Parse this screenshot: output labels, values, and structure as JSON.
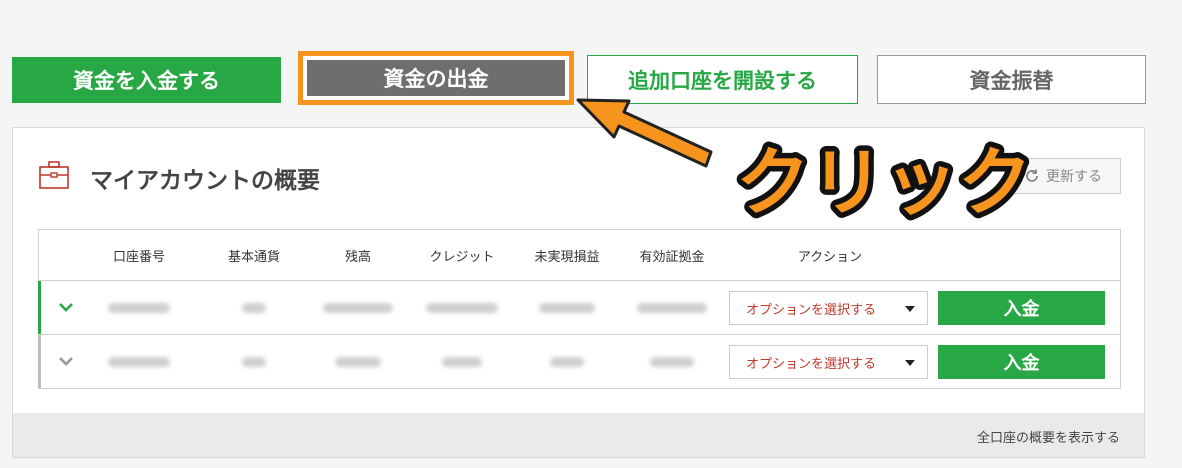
{
  "top_buttons": {
    "deposit": "資金を入金する",
    "withdraw": "資金の出金",
    "add_account": "追加口座を開設する",
    "transfer": "資金振替"
  },
  "panel": {
    "title": "マイアカウントの概要",
    "refresh_label": "更新する",
    "footer_link": "全口座の概要を表示する"
  },
  "table": {
    "columns": [
      "口座番号",
      "基本通貨",
      "残高",
      "クレジット",
      "未実現損益",
      "有効証拠金",
      "アクション"
    ],
    "rows": [
      {
        "status": "expanded",
        "select_label": "オプションを選択する",
        "deposit_label": "入金"
      },
      {
        "status": "collapsed",
        "select_label": "オプションを選択する",
        "deposit_label": "入金"
      }
    ]
  },
  "annotation": {
    "text": "クリック"
  },
  "colors": {
    "green": "#28a745",
    "orange": "#f7941d",
    "gray_button": "#6e6e6e",
    "red_text": "#c0392b"
  }
}
